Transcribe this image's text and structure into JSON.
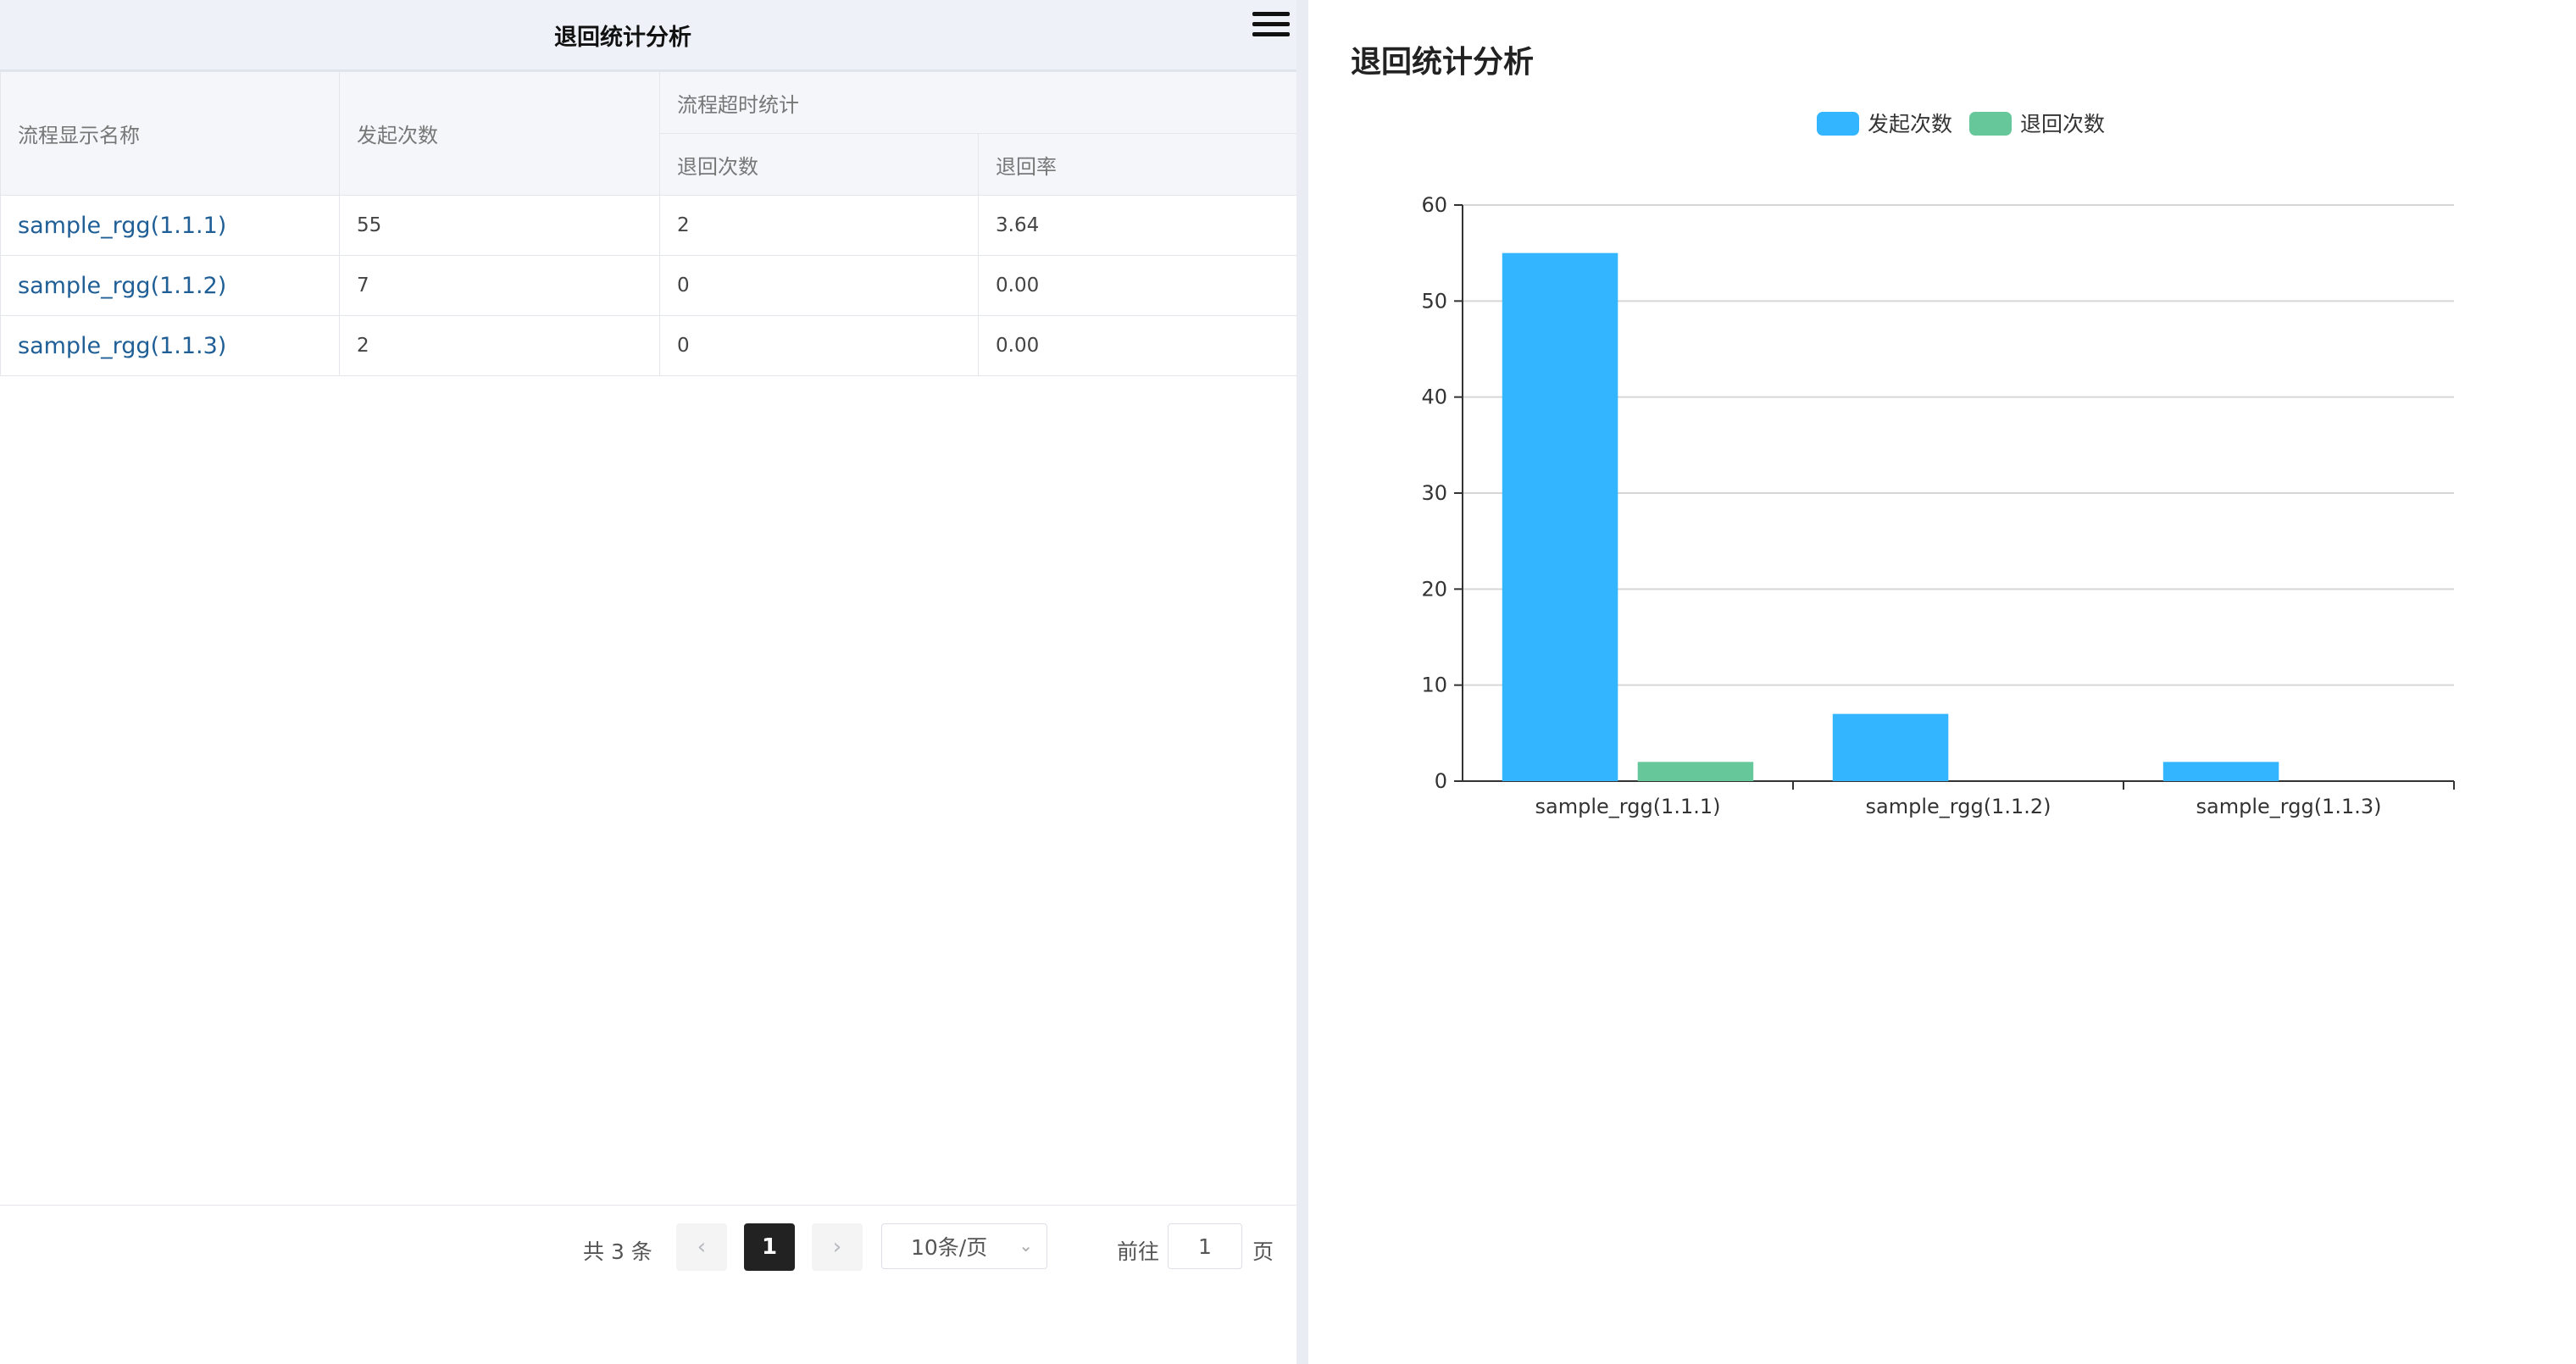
{
  "header": {
    "title": "退回统计分析",
    "menu_icon": "hamburger-menu-icon"
  },
  "table": {
    "col_name": "流程显示名称",
    "col_start_count": "发起次数",
    "group_header": "流程超时统计",
    "col_return_count": "退回次数",
    "col_return_rate": "退回率",
    "rows": [
      {
        "name": "sample_rgg(1.1.1)",
        "start": "55",
        "returns": "2",
        "rate": "3.64"
      },
      {
        "name": "sample_rgg(1.1.2)",
        "start": "7",
        "returns": "0",
        "rate": "0.00"
      },
      {
        "name": "sample_rgg(1.1.3)",
        "start": "2",
        "returns": "0",
        "rate": "0.00"
      }
    ]
  },
  "pagination": {
    "total": "共 3 条",
    "prev_icon": "chevron-left-icon",
    "current_page": "1",
    "next_icon": "chevron-right-icon",
    "page_size": "10条/页",
    "goto_label": "前往",
    "goto_value": "1",
    "goto_suffix": "页"
  },
  "chart_title": "退回统计分析",
  "chart_data": {
    "type": "bar",
    "title": "退回统计分析",
    "categories": [
      "sample_rgg(1.1.1)",
      "sample_rgg(1.1.2)",
      "sample_rgg(1.1.3)"
    ],
    "series": [
      {
        "name": "发起次数",
        "values": [
          55,
          7,
          2
        ],
        "color": "#33b5ff"
      },
      {
        "name": "退回次数",
        "values": [
          2,
          0,
          0
        ],
        "color": "#66c89a"
      }
    ],
    "ylim": [
      0,
      60
    ],
    "yticks": [
      0,
      10,
      20,
      30,
      40,
      50,
      60
    ],
    "grid": true,
    "legend_position": "top-center",
    "xlabel": "",
    "ylabel": ""
  }
}
